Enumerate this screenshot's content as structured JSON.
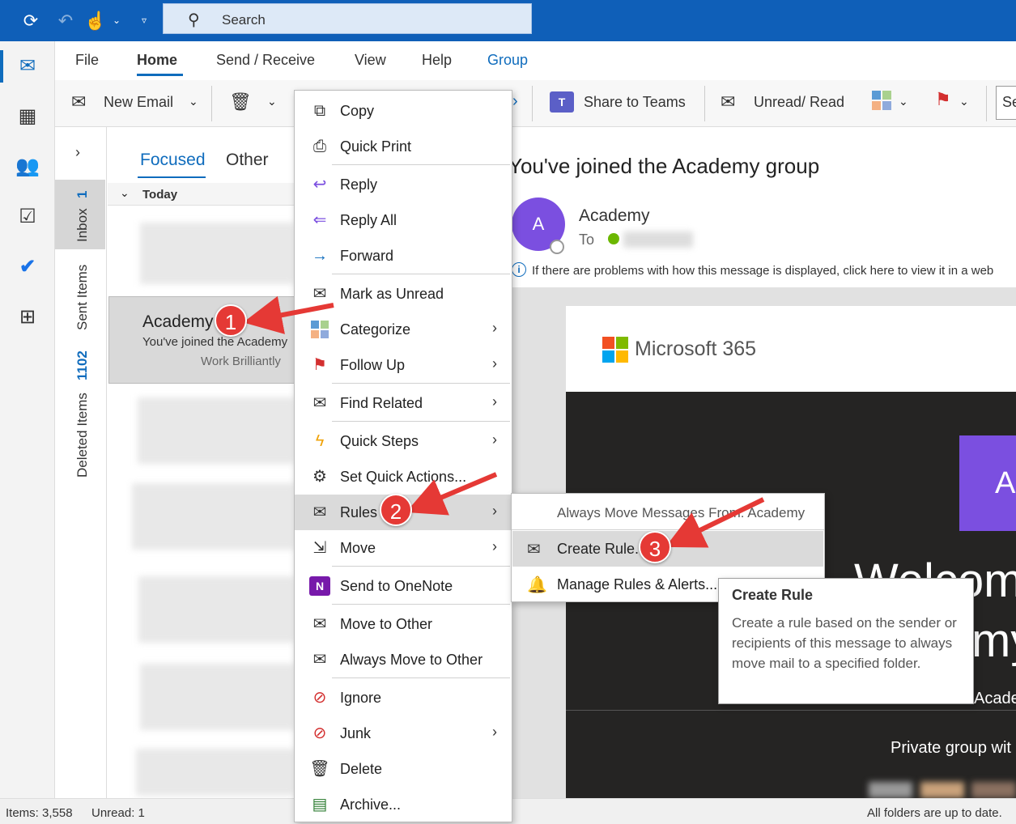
{
  "titlebar": {
    "search_placeholder": "Search"
  },
  "menu_tabs": [
    "File",
    "Home",
    "Send / Receive",
    "View",
    "Help",
    "Group"
  ],
  "ribbon": {
    "new_email": "New Email",
    "share_to_teams": "Share to Teams",
    "unread_read": "Unread/ Read",
    "cut_text": "Se"
  },
  "folders": {
    "inbox": "Inbox",
    "inbox_count": "1",
    "sent": "Sent Items",
    "deleted": "Deleted Items",
    "deleted_count": "1102"
  },
  "message_list": {
    "tab_focused": "Focused",
    "tab_other": "Other",
    "group_today": "Today",
    "selected": {
      "sender": "Academy",
      "subject": "You've joined the Academy",
      "preview": "Work Brilliantly"
    }
  },
  "reading_pane": {
    "subject": "You've joined the Academy group",
    "sender": "Academy",
    "avatar_letter": "A",
    "to_label": "To",
    "info_bar": "If there are problems with how this message is displayed, click here to view it in a web",
    "ms365": "Microsoft 365",
    "badge_letter": "A",
    "welcome": "Welcome",
    "my": "my",
    "acade": "Acade",
    "private": "Private group wit"
  },
  "context_menu": {
    "items": [
      {
        "label": "Copy",
        "icon": "copy-icon"
      },
      {
        "label": "Quick Print",
        "icon": "print-icon"
      },
      {
        "label": "Reply",
        "icon": "reply-icon"
      },
      {
        "label": "Reply All",
        "icon": "reply-all-icon"
      },
      {
        "label": "Forward",
        "icon": "forward-icon"
      },
      {
        "label": "Mark as Unread",
        "icon": "envelope-icon"
      },
      {
        "label": "Categorize",
        "icon": "categorize-icon"
      },
      {
        "label": "Follow Up",
        "icon": "flag-icon"
      },
      {
        "label": "Find Related",
        "icon": "find-related-icon"
      },
      {
        "label": "Quick Steps",
        "icon": "lightning-icon"
      },
      {
        "label": "Set Quick Actions...",
        "icon": "gear-icon"
      },
      {
        "label": "Rules",
        "icon": "rules-icon"
      },
      {
        "label": "Move",
        "icon": "move-icon"
      },
      {
        "label": "Send to OneNote",
        "icon": "onenote-icon"
      },
      {
        "label": "Move to Other",
        "icon": "move-to-other-icon"
      },
      {
        "label": "Always Move to Other",
        "icon": "always-move-icon"
      },
      {
        "label": "Ignore",
        "icon": "ignore-icon"
      },
      {
        "label": "Junk",
        "icon": "junk-icon"
      },
      {
        "label": "Delete",
        "icon": "trash-icon"
      },
      {
        "label": "Archive...",
        "icon": "archive-icon"
      }
    ]
  },
  "submenu": {
    "always_move": "Always Move Messages From: Academy",
    "create_rule": "Create Rule...",
    "manage_rules": "Manage Rules & Alerts..."
  },
  "tooltip": {
    "title": "Create Rule",
    "body": "Create a rule based on the sender or recipients of this message to always move mail to a specified folder."
  },
  "annotations": {
    "step1": "1",
    "step2": "2",
    "step3": "3"
  },
  "status": {
    "items": "Items: 3,558",
    "unread": "Unread: 1",
    "sync": "All folders are up to date."
  },
  "colors": {
    "accent": "#0f6cbd",
    "titlebar": "#0f5fb8",
    "annotation": "#e53935",
    "avatar": "#7b4fe0"
  }
}
